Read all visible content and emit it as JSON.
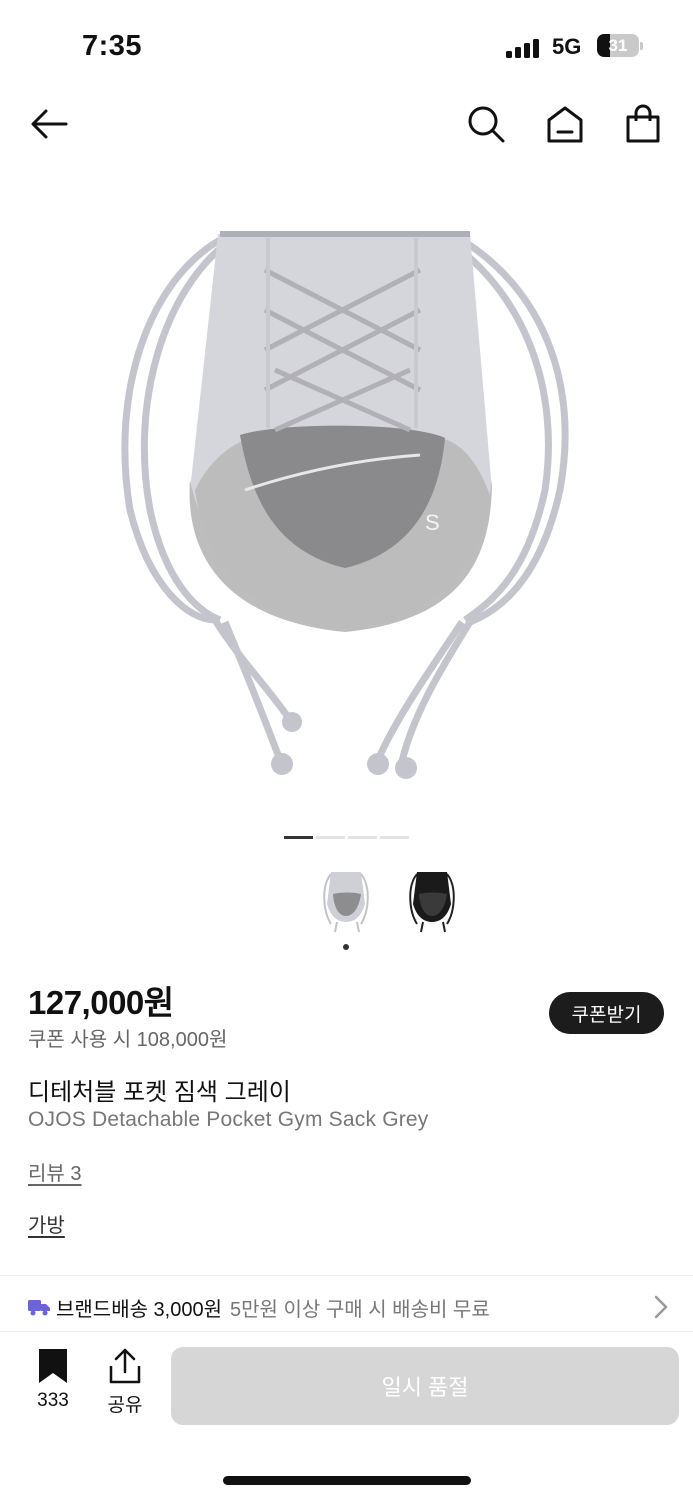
{
  "status_bar": {
    "time": "7:35",
    "network": "5G",
    "battery_level": "31",
    "battery_fraction": 0.31
  },
  "nav": {
    "icons": [
      "arrow-left-icon",
      "search-icon",
      "home-icon",
      "shopping-bag-icon"
    ]
  },
  "gallery": {
    "page_count": 4,
    "active_page": 1,
    "thumbnails": [
      {
        "name": "thumbnail-grey",
        "color": "#bfbfc3"
      },
      {
        "name": "thumbnail-black",
        "color": "#1a1a1a"
      }
    ],
    "selected_thumbnail": 1
  },
  "product": {
    "price": "127,000원",
    "coupon_price": "쿠폰 사용 시 108,000원",
    "coupon_button": "쿠폰받기",
    "name_ko": "디테처블 포켓 짐색 그레이",
    "name_en": "OJOS Detachable Pocket Gym Sack Grey",
    "review_link": "리뷰 3",
    "category_link": "가방"
  },
  "shipping": {
    "brand_label": "브랜드배송 3,000원",
    "note": "5만원 이상 구매 시 배송비 무료",
    "icon": "truck-icon",
    "icon_color": "#6c63d8"
  },
  "bottom_bar": {
    "save_count": "333",
    "share_label": "공유",
    "soldout_label": "일시 품절"
  }
}
